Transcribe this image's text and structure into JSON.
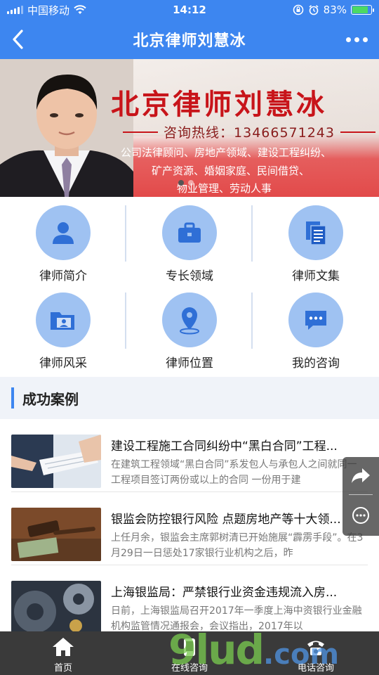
{
  "status_bar": {
    "carrier": "中国移动",
    "time": "14:12",
    "battery_percent": "83%",
    "battery_level": 0.83
  },
  "nav": {
    "back_icon": "chevron-left-icon",
    "title": "北京律师刘慧冰",
    "more_icon": "more-dots-icon"
  },
  "banner": {
    "headline": "北京律师刘慧冰",
    "hotline": "咨询热线：13466571243",
    "line1": "公司法律顾问、房地产领域、建设工程纠纷、",
    "line2": "矿产资源、婚姻家庭、民间借贷、",
    "line3": "物业管理、劳动人事",
    "slide_count": 2,
    "active_slide": 1
  },
  "menu": [
    {
      "label": "律师简介",
      "icon": "person-icon"
    },
    {
      "label": "专长领域",
      "icon": "briefcase-icon"
    },
    {
      "label": "律师文集",
      "icon": "documents-icon"
    },
    {
      "label": "律师风采",
      "icon": "folder-person-icon"
    },
    {
      "label": "律师位置",
      "icon": "location-pin-icon"
    },
    {
      "label": "我的咨询",
      "icon": "chat-bubble-icon"
    }
  ],
  "section": {
    "title": "成功案例"
  },
  "cases": [
    {
      "title": "建设工程施工合同纠纷中“黑白合同”工程...",
      "desc": "在建筑工程领域“黑白合同”系发包人与承包人之间就同一工程项目签订两份或以上的合同 一份用于建"
    },
    {
      "title": "银监会防控银行风险 点题房地产等十大领...",
      "desc": "上任月余，银监会主席郭树清已开始施展“霹雳手段”。在3月29日一日惩处17家银行业机构之后，昨"
    },
    {
      "title": "上海银监局：严禁银行业资金违规流入房...",
      "desc": "日前，上海银监局召开2017年一季度上海中资银行业金融机构监管情况通报会，会议指出，2017年以"
    }
  ],
  "float_tool": {
    "share_icon": "share-arrow-icon",
    "chat_icon": "chat-icon"
  },
  "tabs": [
    {
      "label": "首页",
      "icon": "home-icon"
    },
    {
      "label": "在线咨询",
      "icon": "online-consult-icon"
    },
    {
      "label": "电话咨询",
      "icon": "phone-icon"
    }
  ],
  "watermark": {
    "text": "9lud",
    "suffix": ".com"
  },
  "colors": {
    "accent": "#3d86f0",
    "icon_circle": "#9fc2f2",
    "tab_bar": "#3a3a3a",
    "banner_red": "#c8141a"
  }
}
